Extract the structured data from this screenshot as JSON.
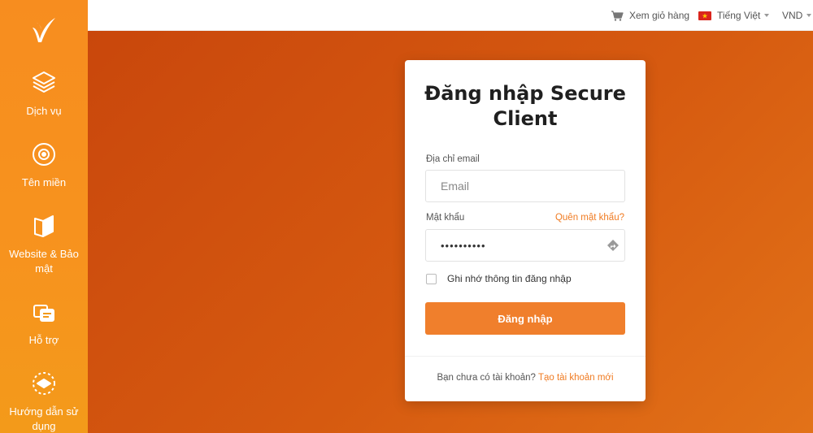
{
  "sidebar": {
    "items": [
      {
        "label": "Dịch vụ",
        "icon": "box-icon"
      },
      {
        "label": "Tên miền",
        "icon": "globe-icon"
      },
      {
        "label": "Website & Bảo mật",
        "icon": "book-icon"
      },
      {
        "label": "Hỗ trợ",
        "icon": "support-icon"
      },
      {
        "label": "Hướng dẫn sử dụng",
        "icon": "guide-icon"
      }
    ]
  },
  "topbar": {
    "cart_label": "Xem giỏ hàng",
    "language_label": "Tiếng Việt",
    "currency_label": "VND"
  },
  "login": {
    "title": "Đăng nhập Secure Client",
    "email_label": "Địa chỉ email",
    "email_placeholder": "Email",
    "password_label": "Mật khẩu",
    "forgot_label": "Quên mật khẩu?",
    "password_value": "••••••••••",
    "remember_label": "Ghi nhớ thông tin đăng nhập",
    "submit_label": "Đăng nhập",
    "no_account_text": "Bạn chưa có tài khoản?",
    "signup_label": "Tạo tài khoản mới"
  },
  "colors": {
    "sidebar": "#f78d1f",
    "background": "#d65a10",
    "accent": "#f07f2c",
    "link": "#f07b22"
  }
}
